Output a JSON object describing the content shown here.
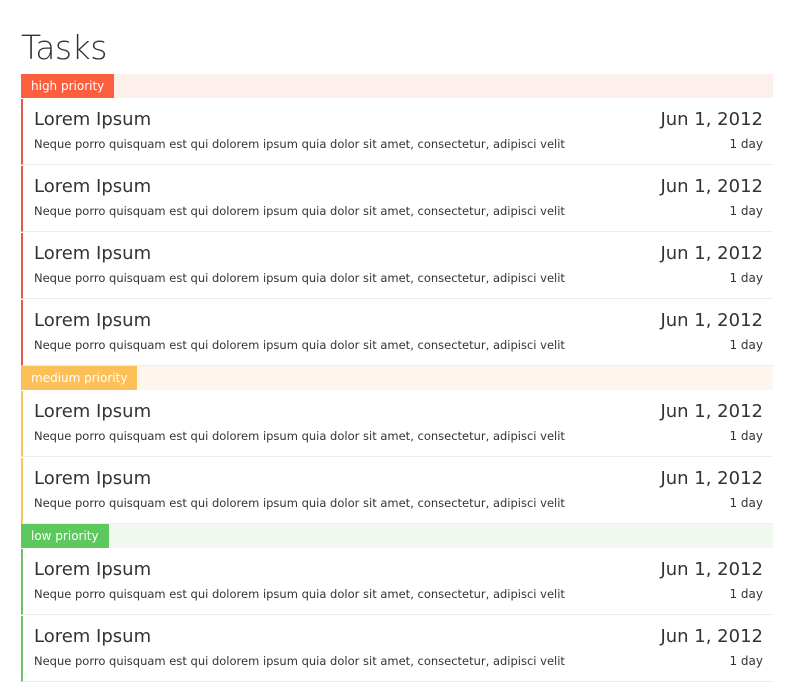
{
  "page": {
    "title": "Tasks"
  },
  "colors": {
    "high": "#fd5e3d",
    "high_bg": "#fdefec",
    "high_border": "#e05a47",
    "medium": "#fdbf58",
    "medium_bg": "#fef6ee",
    "medium_border": "#f3c45f",
    "low": "#5cc85d",
    "low_bg": "#f1f8f0",
    "low_border": "#6cc26a"
  },
  "groups": [
    {
      "label": "high priority",
      "color_key": "high",
      "tasks": [
        {
          "title": "Lorem Ipsum",
          "description": "Neque porro quisquam est qui dolorem ipsum quia dolor sit amet, consectetur, adipisci velit",
          "date": "Jun 1, 2012",
          "duration": "1 day"
        },
        {
          "title": "Lorem Ipsum",
          "description": "Neque porro quisquam est qui dolorem ipsum quia dolor sit amet, consectetur, adipisci velit",
          "date": "Jun 1, 2012",
          "duration": "1 day"
        },
        {
          "title": "Lorem Ipsum",
          "description": "Neque porro quisquam est qui dolorem ipsum quia dolor sit amet, consectetur, adipisci velit",
          "date": "Jun 1, 2012",
          "duration": "1 day"
        },
        {
          "title": "Lorem Ipsum",
          "description": "Neque porro quisquam est qui dolorem ipsum quia dolor sit amet, consectetur, adipisci velit",
          "date": "Jun 1, 2012",
          "duration": "1 day"
        }
      ]
    },
    {
      "label": "medium priority",
      "color_key": "medium",
      "tasks": [
        {
          "title": "Lorem Ipsum",
          "description": "Neque porro quisquam est qui dolorem ipsum quia dolor sit amet, consectetur, adipisci velit",
          "date": "Jun 1, 2012",
          "duration": "1 day"
        },
        {
          "title": "Lorem Ipsum",
          "description": "Neque porro quisquam est qui dolorem ipsum quia dolor sit amet, consectetur, adipisci velit",
          "date": "Jun 1, 2012",
          "duration": "1 day"
        }
      ]
    },
    {
      "label": "low priority",
      "color_key": "low",
      "tasks": [
        {
          "title": "Lorem Ipsum",
          "description": "Neque porro quisquam est qui dolorem ipsum quia dolor sit amet, consectetur, adipisci velit",
          "date": "Jun 1, 2012",
          "duration": "1 day"
        },
        {
          "title": "Lorem Ipsum",
          "description": "Neque porro quisquam est qui dolorem ipsum quia dolor sit amet, consectetur, adipisci velit",
          "date": "Jun 1, 2012",
          "duration": "1 day"
        }
      ]
    }
  ]
}
